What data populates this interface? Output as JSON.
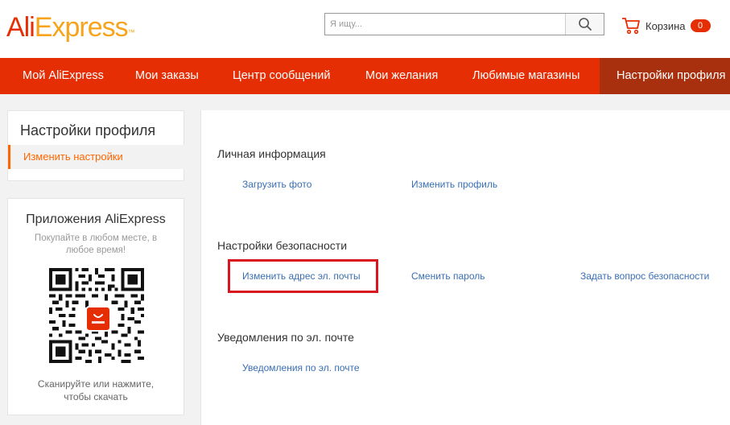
{
  "header": {
    "logo_ali": "Ali",
    "logo_express": "Express",
    "logo_tm": "™",
    "search_placeholder": "Я ищу...",
    "cart_label": "Корзина",
    "cart_count": "0"
  },
  "nav": {
    "items": [
      {
        "label": "Мой AliExpress"
      },
      {
        "label": "Мои заказы"
      },
      {
        "label": "Центр сообщений"
      },
      {
        "label": "Мои желания"
      },
      {
        "label": "Любимые магазины"
      },
      {
        "label": "Настройки профиля"
      }
    ],
    "active_index": 5
  },
  "sidebar": {
    "title": "Настройки профиля",
    "item": "Изменить настройки"
  },
  "apps_panel": {
    "title": "Приложения AliExpress",
    "subtitle": "Покупайте в любом месте, в любое время!",
    "caption": "Сканируйте или нажмите, чтобы скачать"
  },
  "main": {
    "personal": {
      "title": "Личная информация",
      "upload_photo": "Загрузить фото",
      "edit_profile": "Изменить профиль"
    },
    "security": {
      "title": "Настройки безопасности",
      "change_email": "Изменить адрес эл. почты",
      "change_password": "Сменить пароль",
      "security_question": "Задать вопрос безопасности"
    },
    "notifications": {
      "title": "Уведомления по эл. почте",
      "email_notifications": "Уведомления по эл. почте"
    }
  },
  "colors": {
    "brand_red": "#e62e04",
    "nav_active": "#a8300f",
    "link_blue": "#3a6fb4",
    "accent_orange": "#f60",
    "highlight_red": "#d9161f"
  },
  "icons": {
    "search": "search-icon",
    "cart": "cart-icon",
    "qr": "qr-code-icon"
  }
}
